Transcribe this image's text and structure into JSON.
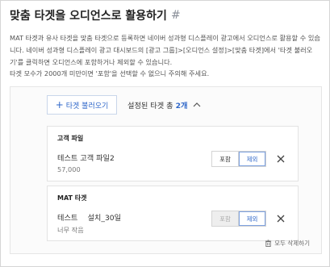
{
  "header": {
    "title": "맞춤 타겟을 오디언스로 활용하기",
    "hash_symbol": "#"
  },
  "description": "MAT 타겟과 유사 타겟을 맞춤 타겟으로 등록하면 네이버 성과형 디스플레이 광고에서 오디언스로 활용할 수 있습니다. 네이버 성과형 디스플레이 광고 대시보드의 [광고 그룹]>[오디언스 설정]>[맞춤 타겟]에서 '타겟 불러오기'를 클릭하면 오디언스에 포함하거나 제외할 수 있습니다.",
  "note": "타겟 모수가 2000개 미만이면 '포함'을 선택할 수 없으니 주의해 주세요.",
  "panel": {
    "load_button_label": "타겟 불러오기",
    "summary_label": "설정된 타겟 총",
    "summary_count": "2개",
    "delete_all_label": "모두 삭제하기"
  },
  "targets": [
    {
      "category": "고객 파일",
      "name": "테스트 고객 파일2",
      "size": "57,000",
      "include_label": "포함",
      "exclude_label": "제외",
      "include_disabled": false,
      "selected": "exclude"
    },
    {
      "category": "MAT 타겟",
      "name": "테스트 　설치_30일",
      "size": "너무 작음",
      "include_label": "포함",
      "exclude_label": "제외",
      "include_disabled": true,
      "selected": "exclude"
    }
  ],
  "colors": {
    "accent": "#2f67c9",
    "border": "#d6d6d6",
    "disabled_bg": "#eeeeee"
  },
  "icons": {
    "load": "plus-icon",
    "collapse": "chevron-up-icon",
    "remove": "close-icon",
    "delete_all": "trash-icon"
  }
}
